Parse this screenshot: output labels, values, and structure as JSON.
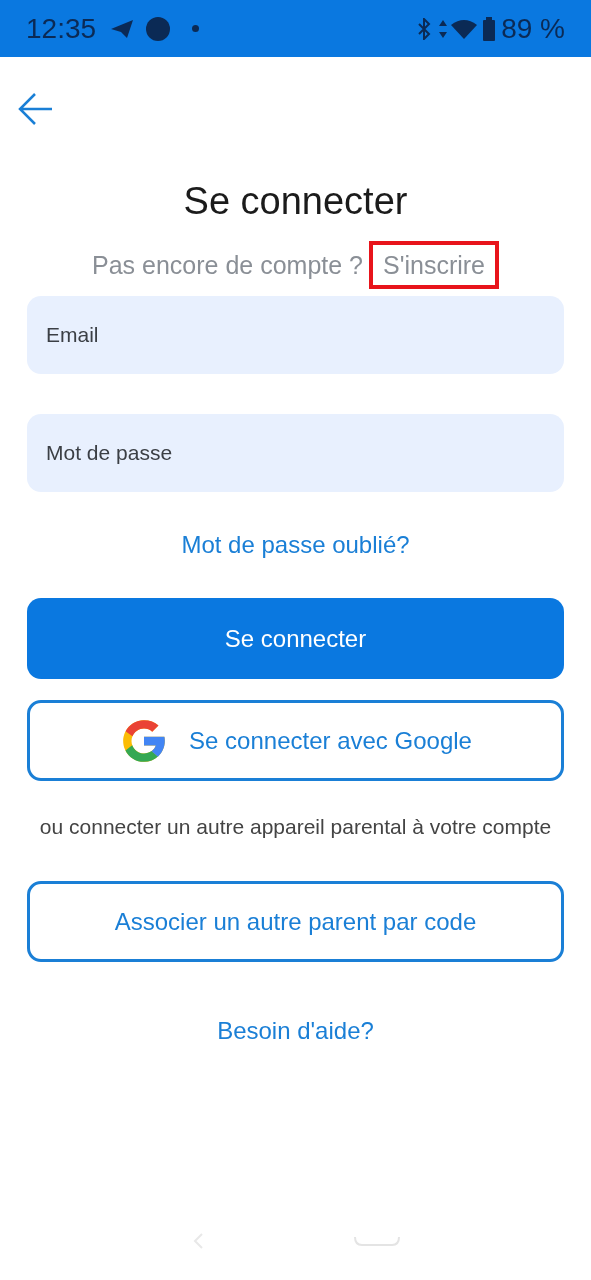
{
  "status_bar": {
    "time": "12:35",
    "battery": "89 %"
  },
  "title": "Se connecter",
  "signup": {
    "prompt": "Pas encore de compte ?",
    "link": "S'inscrire",
    "highlighted": true
  },
  "fields": [
    {
      "placeholder": "Email"
    },
    {
      "placeholder": "Mot de passe"
    }
  ],
  "forgot_link": "Mot de passe oublié?",
  "primary_button": "Se connecter",
  "google_button": "Se connecter avec Google",
  "other_device_text": "ou connecter un autre appareil parental à votre compte",
  "associate_button": "Associer un autre parent par code",
  "help_link": "Besoin d'aide?"
}
